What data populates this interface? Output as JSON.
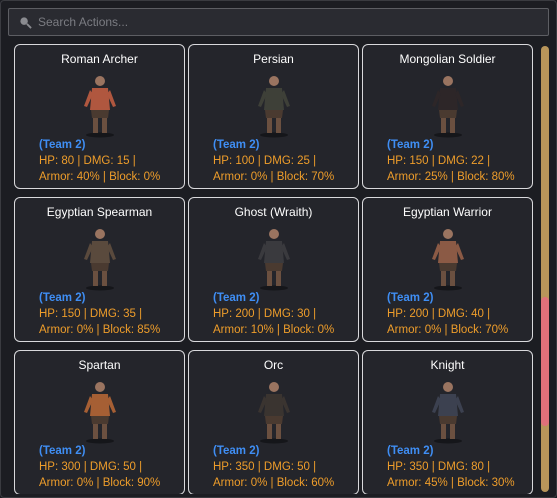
{
  "search": {
    "placeholder": "Search Actions..."
  },
  "colors": {
    "team": "#3f8ef4",
    "stats": "#ee9d2b",
    "card_border": "#d9d9dc",
    "scroll_track": "#b8955a",
    "scroll_thumb": "#e0707a"
  },
  "scrollbar": {
    "position_fraction": 0.56
  },
  "cards": [
    {
      "name": "Roman Archer",
      "team": "(Team 2)",
      "stats1": "HP: 80 | DMG: 15 |",
      "stats2": "Armor: 40% | Block: 0%",
      "figure": "roman-archer-figure",
      "tint": "#b0573f"
    },
    {
      "name": "Persian",
      "team": "(Team 2)",
      "stats1": "HP: 100 | DMG: 25 |",
      "stats2": "Armor: 0% | Block: 70%",
      "figure": "persian-figure",
      "tint": "#3e4038"
    },
    {
      "name": "Mongolian Soldier",
      "team": "(Team 2)",
      "stats1": "HP: 150 | DMG: 22 |",
      "stats2": "Armor: 25% | Block: 80%",
      "figure": "mongolian-soldier-figure",
      "tint": "#2d2628"
    },
    {
      "name": "Egyptian Spearman",
      "team": "(Team 2)",
      "stats1": "HP: 150 | DMG: 35 |",
      "stats2": "Armor: 0% | Block: 85%",
      "figure": "egyptian-spearman-figure",
      "tint": "#5a4a3d"
    },
    {
      "name": "Ghost (Wraith)",
      "team": "(Team 2)",
      "stats1": "HP: 200 | DMG: 30 |",
      "stats2": "Armor: 10% | Block: 0%",
      "figure": "ghost-wraith-figure",
      "tint": "#3a3a3e"
    },
    {
      "name": "Egyptian Warrior",
      "team": "(Team 2)",
      "stats1": "HP: 200 | DMG: 40 |",
      "stats2": "Armor: 0% | Block: 70%",
      "figure": "egyptian-warrior-figure",
      "tint": "#8b5a45"
    },
    {
      "name": "Spartan",
      "team": "(Team 2)",
      "stats1": "HP: 300 | DMG: 50 |",
      "stats2": "Armor: 0% | Block: 90%",
      "figure": "spartan-figure",
      "tint": "#a65f34"
    },
    {
      "name": "Orc",
      "team": "(Team 2)",
      "stats1": "HP: 350 | DMG: 50 |",
      "stats2": "Armor: 0% | Block: 60%",
      "figure": "orc-figure",
      "tint": "#3a3430"
    },
    {
      "name": "Knight",
      "team": "(Team 2)",
      "stats1": "HP: 350 | DMG: 80 |",
      "stats2": "Armor: 45% | Block: 30%",
      "figure": "knight-figure",
      "tint": "#3c4150"
    }
  ]
}
